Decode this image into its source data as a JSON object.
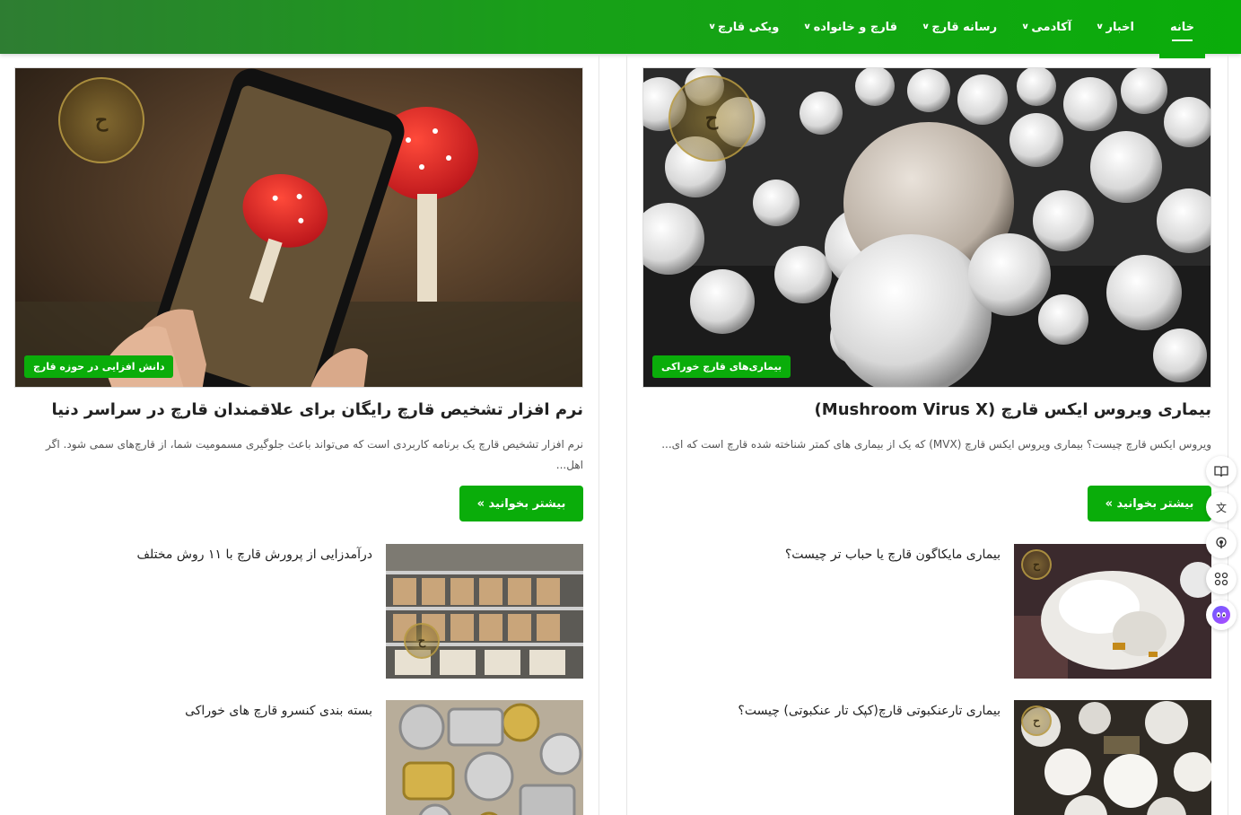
{
  "nav": {
    "items": [
      {
        "label": "خانه",
        "active": true,
        "dropdown": false
      },
      {
        "label": "اخبار",
        "active": false,
        "dropdown": true
      },
      {
        "label": "آکادمی",
        "active": false,
        "dropdown": true
      },
      {
        "label": "رسانه قارچ",
        "active": false,
        "dropdown": true
      },
      {
        "label": "قارچ و خانواده",
        "active": false,
        "dropdown": true
      },
      {
        "label": "ویکی قارچ",
        "active": false,
        "dropdown": true
      }
    ]
  },
  "logo_watermark": "HAGO",
  "right_column": {
    "hero": {
      "image": "white button mushrooms growing in dark compost",
      "tag": "بیماری‌های قارچ خوراکی",
      "title": "بیماری ویروس ایکس قارچ (Mushroom Virus X)",
      "excerpt": "ویروس ایکس قارچ چیست؟ بیماری ویروس ایکس قارچ (MVX) که یک از بیماری های کمتر شناخته شده قارچ است که ای...",
      "read_more": "بیشتر بخوانید »"
    },
    "list": [
      {
        "title": "بیماری مایکاگون قارچ یا حباب تر چیست؟",
        "image": "mushroom with wet bubble disease"
      },
      {
        "title": "بیماری تارعنکبوتی قارچ(کپک تار عنکبوتی) چیست؟",
        "image": "button mushrooms with cobweb mold"
      }
    ]
  },
  "left_column": {
    "hero": {
      "image": "hands holding phone photographing red fly agaric mushroom",
      "tag": "دانش افزایی در حوزه قارچ",
      "title": "نرم افزار تشخیص قارچ رایگان برای علاقمندان قارچ در سراسر دنیا",
      "excerpt": "نرم افزار تشخیص قارچ یک برنامه کاربردی است که می‌تواند باعث جلوگیری مسمومیت شما، از قارچ‌های سمی شود. اگر اهل...",
      "read_more": "بیشتر بخوانید »"
    },
    "list": [
      {
        "title": "درآمدزایی از پرورش قارچ با ۱۱ روش مختلف",
        "image": "supermarket shelf of packaged mushrooms"
      },
      {
        "title": "بسته بندی کنسرو قارچ های خوراکی",
        "image": "assorted empty tin cans"
      }
    ]
  },
  "side_tools": [
    {
      "name": "reader-icon",
      "glyph": "📖"
    },
    {
      "name": "translate-icon",
      "glyph": "文"
    },
    {
      "name": "podcast-icon",
      "glyph": "◉"
    },
    {
      "name": "apps-icon",
      "glyph": "⊞"
    },
    {
      "name": "assistant-icon",
      "glyph": "••"
    }
  ],
  "colors": {
    "brand_green": "#0aad0a",
    "nav_gradient_start": "#2e7d32"
  }
}
